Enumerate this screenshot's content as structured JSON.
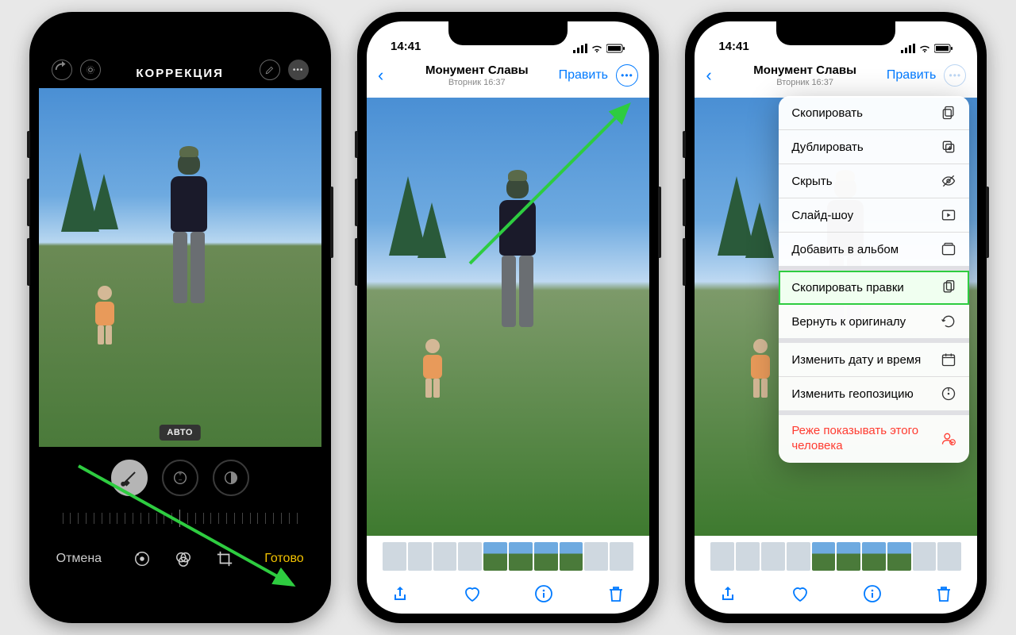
{
  "phone1": {
    "title": "КОРРЕКЦИЯ",
    "auto_badge": "АВТО",
    "cancel": "Отмена",
    "done": "Готово"
  },
  "phone2": {
    "time": "14:41",
    "location_title": "Монумент Славы",
    "location_sub": "Вторник 16:37",
    "edit": "Править"
  },
  "phone3": {
    "time": "14:41",
    "location_title": "Монумент Славы",
    "location_sub": "Вторник 16:37",
    "edit": "Править",
    "menu": [
      {
        "label": "Скопировать",
        "icon": "copy"
      },
      {
        "label": "Дублировать",
        "icon": "duplicate"
      },
      {
        "label": "Скрыть",
        "icon": "hide"
      },
      {
        "label": "Слайд-шоу",
        "icon": "play"
      },
      {
        "label": "Добавить в альбом",
        "icon": "album"
      },
      {
        "label": "Скопировать правки",
        "icon": "copy-edits"
      },
      {
        "label": "Вернуть к оригиналу",
        "icon": "revert"
      },
      {
        "label": "Изменить дату и время",
        "icon": "date"
      },
      {
        "label": "Изменить геопозицию",
        "icon": "geo"
      },
      {
        "label": "Реже показывать этого человека",
        "icon": "person"
      }
    ]
  }
}
